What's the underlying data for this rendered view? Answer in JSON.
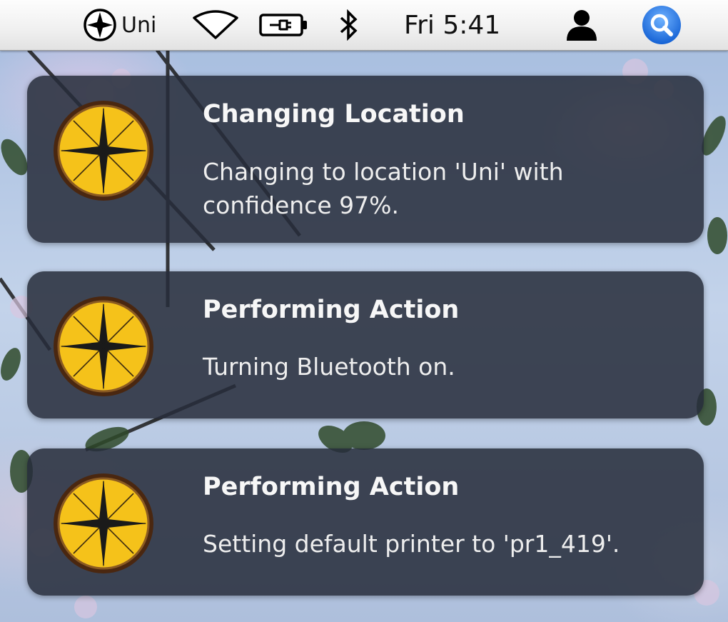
{
  "menubar": {
    "location_icon": "compass-icon",
    "location_label": "Uni",
    "wifi_icon": "wifi-icon",
    "battery_icon": "battery-charging-icon",
    "bluetooth_icon": "bluetooth-icon",
    "clock": "Fri 5:41",
    "user_icon": "user-icon",
    "spotlight_icon": "spotlight-search-icon",
    "spotlight_color": "#2f7fe8"
  },
  "notifications": [
    {
      "icon": "compass-icon",
      "title": "Changing Location",
      "message": "Changing to location 'Uni' with confidence 97%."
    },
    {
      "icon": "compass-icon",
      "title": "Performing Action",
      "message": "Turning Bluetooth on."
    },
    {
      "icon": "compass-icon",
      "title": "Performing Action",
      "message": "Setting default printer to 'pr1_419'."
    }
  ],
  "colors": {
    "notification_bg": "#262c3a",
    "compass_face": "#f5c21a",
    "compass_rim": "#5a2f12"
  }
}
